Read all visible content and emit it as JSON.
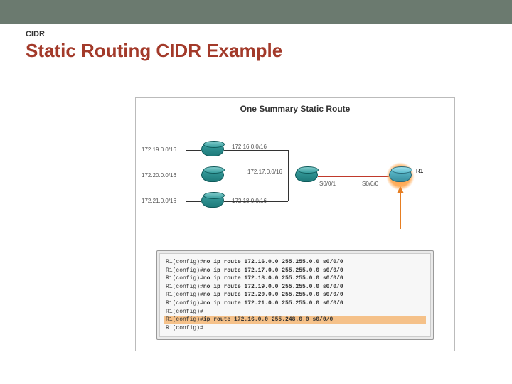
{
  "header": {
    "eyebrow": "CIDR",
    "title": "Static Routing CIDR Example"
  },
  "diagram": {
    "title": "One Summary Static Route",
    "left_nets": [
      "172.19.0.0/16",
      "172.20.0.0/16",
      "172.21.0.0/16"
    ],
    "mid_nets": [
      "172.16.0.0/16",
      "172.17.0.0/16",
      "172.18.0.0/16"
    ],
    "serial_left": "S0/0/1",
    "serial_right": "S0/0/0",
    "r1_label": "R1"
  },
  "cli": {
    "lines": [
      {
        "prompt": "R1(config)#",
        "cmd": "no ip route 172.16.0.0 255.255.0.0 s0/0/0",
        "hl": false
      },
      {
        "prompt": "R1(config)#",
        "cmd": "no ip route 172.17.0.0 255.255.0.0 s0/0/0",
        "hl": false
      },
      {
        "prompt": "R1(config)#",
        "cmd": "no ip route 172.18.0.0 255.255.0.0 s0/0/0",
        "hl": false
      },
      {
        "prompt": "R1(config)#",
        "cmd": "no ip route 172.19.0.0 255.255.0.0 s0/0/0",
        "hl": false
      },
      {
        "prompt": "R1(config)#",
        "cmd": "no ip route 172.20.0.0 255.255.0.0 s0/0/0",
        "hl": false
      },
      {
        "prompt": "R1(config)#",
        "cmd": "no ip route 172.21.0.0 255.255.0.0 s0/0/0",
        "hl": false
      },
      {
        "prompt": "R1(config)#",
        "cmd": "",
        "hl": false
      },
      {
        "prompt": "R1(config)#",
        "cmd": "ip route 172.16.0.0 255.248.0.0 s0/0/0",
        "hl": true
      },
      {
        "prompt": "R1(config)#",
        "cmd": "",
        "hl": false
      }
    ]
  }
}
